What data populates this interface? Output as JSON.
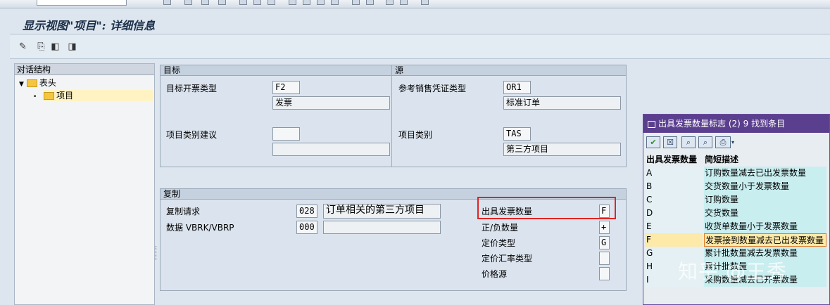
{
  "window": {
    "title": "显示视图\"项目\": 详细信息"
  },
  "tree": {
    "header": "对话结构",
    "items": [
      {
        "label": "表头",
        "expanded": true
      },
      {
        "label": "项目",
        "selected": true
      }
    ]
  },
  "target": {
    "header": "目标",
    "billing_type_label": "目标开票类型",
    "billing_type_value": "F2",
    "billing_type_desc": "发票",
    "item_cat_label": "项目类别建议",
    "item_cat_value": "",
    "item_cat_desc": ""
  },
  "source": {
    "header": "源",
    "ref_doc_label": "参考销售凭证类型",
    "ref_doc_value": "OR1",
    "ref_doc_desc": "标准订单",
    "item_cat_label": "项目类别",
    "item_cat_value": "TAS",
    "item_cat_desc": "第三方项目"
  },
  "copy": {
    "header": "复制",
    "copy_req_label": "复制请求",
    "copy_req_value": "028",
    "copy_req_desc": "订单相关的第三方项目",
    "data_label": "数据 VBRK/VBRP",
    "data_value": "000",
    "data_desc": "",
    "billing_qty_label": "出具发票数量",
    "billing_qty_value": "F",
    "pos_neg_label": "正/负数量",
    "pos_neg_value": "+",
    "pricing_type_label": "定价类型",
    "pricing_type_value": "G",
    "exch_rate_label": "定价汇率类型",
    "exch_rate_value": "",
    "price_source_label": "价格源",
    "price_source_value": ""
  },
  "popup": {
    "title": "出具发票数量标志 (2)   9 找到条目",
    "col_code": "出具发票数量",
    "col_desc": "简短描述",
    "rows": [
      {
        "code": "A",
        "desc": "订购数量减去已出发票数量"
      },
      {
        "code": "B",
        "desc": "交货数量小于发票数量"
      },
      {
        "code": "C",
        "desc": "订购数量"
      },
      {
        "code": "D",
        "desc": "交货数量"
      },
      {
        "code": "E",
        "desc": "收货单数量小于发票数量"
      },
      {
        "code": "F",
        "desc": "发票接到数量减去已出发票数量"
      },
      {
        "code": "G",
        "desc": "累计批数量减去发票数量"
      },
      {
        "code": "H",
        "desc": "累计批数量"
      },
      {
        "code": "I",
        "desc": "采购数量减去已开票数量"
      }
    ],
    "selected_code": "F"
  },
  "watermark": "知乎 @王秀",
  "colors": {
    "highlight": "#e02424",
    "popup_header": "#5b3f8f",
    "selected_row": "#fde9a8"
  }
}
